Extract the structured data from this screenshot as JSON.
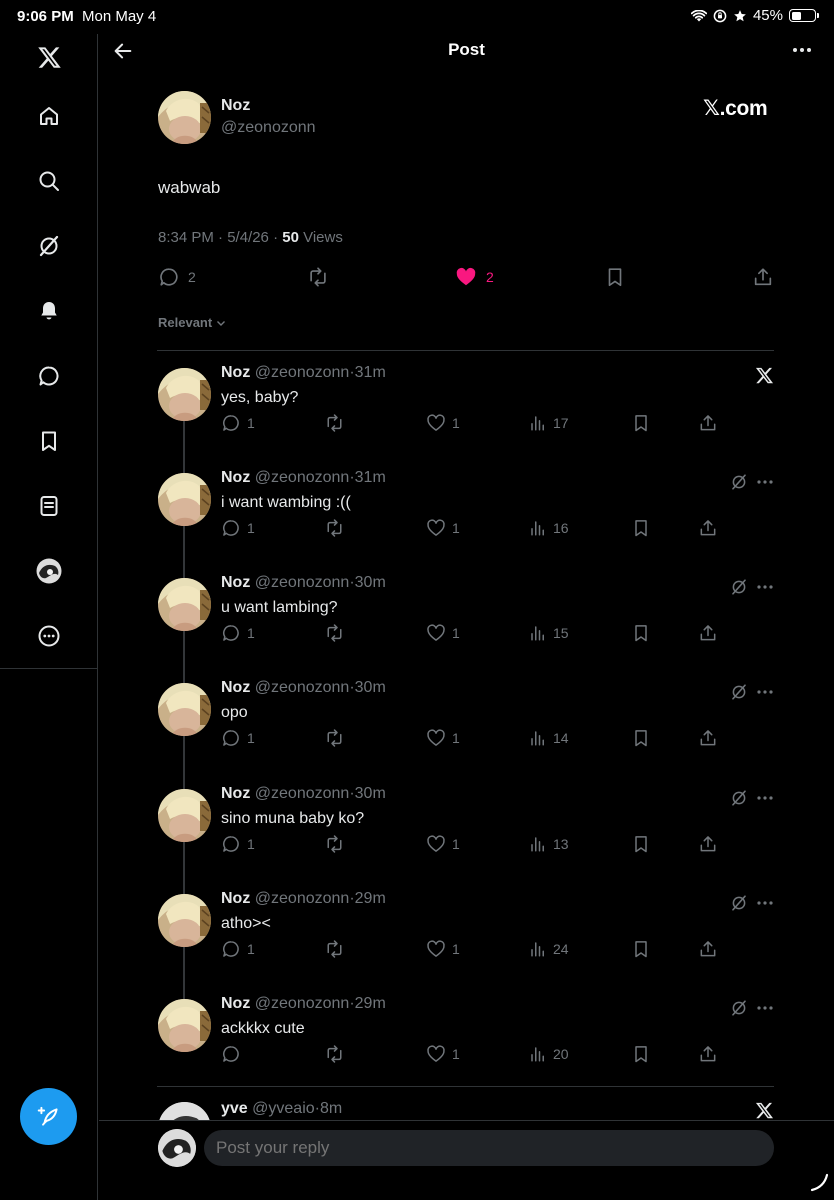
{
  "status_bar": {
    "time": "9:06 PM",
    "date": "Mon May 4",
    "battery": "45%",
    "battery_level": 0.45
  },
  "sidebar": {
    "items": [
      {
        "name": "x-logo-icon"
      },
      {
        "name": "home-icon"
      },
      {
        "name": "search-icon"
      },
      {
        "name": "grok-icon"
      },
      {
        "name": "bell-icon"
      },
      {
        "name": "messages-icon"
      },
      {
        "name": "bookmark-icon"
      },
      {
        "name": "lists-icon"
      },
      {
        "name": "profile-avatar"
      },
      {
        "name": "more-circle-icon"
      }
    ],
    "compose_icon": "feather-plus-icon"
  },
  "header": {
    "title": "Post"
  },
  "post": {
    "name": "Noz",
    "handle": "@zeonozonn",
    "brand": "𝕏.com",
    "text": "wabwab",
    "meta_time": "8:34 PM · 5/4/26 · ",
    "views_count": "50",
    "views_label": " Views",
    "replies": "2",
    "likes": "2",
    "sort_label": "Relevant"
  },
  "colors": {
    "accent": "#1d9bf0",
    "like": "#f91880",
    "muted": "#71767b",
    "text": "#e7e9ea"
  },
  "replies": [
    {
      "name": "Noz",
      "handle": "@zeonozonn",
      "time": "31m",
      "text": "yes, baby?",
      "replies": "1",
      "likes": "1",
      "views": "17",
      "badge": "x"
    },
    {
      "name": "Noz",
      "handle": "@zeonozonn",
      "time": "31m",
      "text": "i want wambing :((",
      "replies": "1",
      "likes": "1",
      "views": "16",
      "badge": "grok"
    },
    {
      "name": "Noz",
      "handle": "@zeonozonn",
      "time": "30m",
      "text": "u want lambing?",
      "replies": "1",
      "likes": "1",
      "views": "15",
      "badge": "grok"
    },
    {
      "name": "Noz",
      "handle": "@zeonozonn",
      "time": "30m",
      "text": "opo",
      "replies": "1",
      "likes": "1",
      "views": "14",
      "badge": "grok"
    },
    {
      "name": "Noz",
      "handle": "@zeonozonn",
      "time": "30m",
      "text": "sino muna baby ko?",
      "replies": "1",
      "likes": "1",
      "views": "13",
      "badge": "grok"
    },
    {
      "name": "Noz",
      "handle": "@zeonozonn",
      "time": "29m",
      "text": "atho><",
      "replies": "1",
      "likes": "1",
      "views": "24",
      "badge": "grok"
    },
    {
      "name": "Noz",
      "handle": "@zeonozonn",
      "time": "29m",
      "text": "ackkkx cute",
      "replies": "",
      "likes": "1",
      "views": "20",
      "badge": "grok"
    }
  ],
  "partial_reply": {
    "name": "yve",
    "handle": "@yveaio",
    "time": "8m"
  },
  "composer": {
    "placeholder": "Post your reply"
  }
}
